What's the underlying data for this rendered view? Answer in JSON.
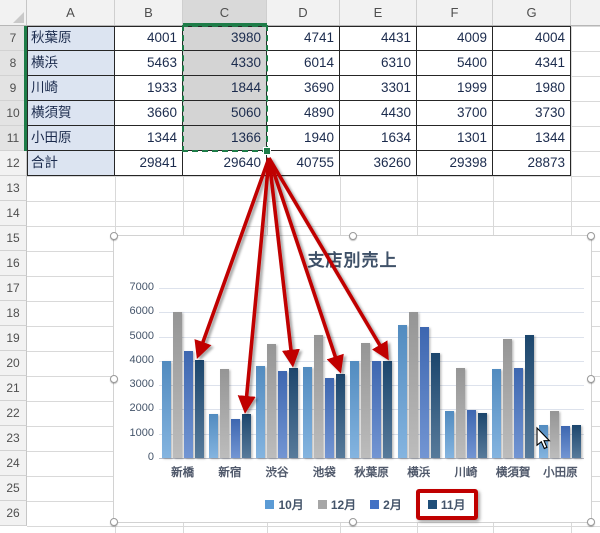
{
  "sheet": {
    "column_headers": [
      "A",
      "B",
      "C",
      "D",
      "E",
      "F",
      "G"
    ],
    "row_numbers": [
      "7",
      "8",
      "9",
      "10",
      "11",
      "12",
      "13",
      "14",
      "15",
      "16",
      "17",
      "18",
      "19",
      "20",
      "21",
      "22",
      "23",
      "24",
      "25",
      "26"
    ],
    "selection": {
      "column": "C",
      "row_start": 7,
      "row_end": 11
    },
    "table_rows": [
      {
        "row": "7",
        "label": "秋葉原",
        "values": [
          "4001",
          "3980",
          "4741",
          "4431",
          "4009",
          "4004"
        ]
      },
      {
        "row": "8",
        "label": "横浜",
        "values": [
          "5463",
          "4330",
          "6014",
          "6310",
          "5400",
          "4341"
        ]
      },
      {
        "row": "9",
        "label": "川崎",
        "values": [
          "1933",
          "1844",
          "3690",
          "3301",
          "1999",
          "1980"
        ]
      },
      {
        "row": "10",
        "label": "横須賀",
        "values": [
          "3660",
          "5060",
          "4890",
          "4430",
          "3700",
          "3730"
        ]
      },
      {
        "row": "11",
        "label": "小田原",
        "values": [
          "1344",
          "1366",
          "1940",
          "1634",
          "1301",
          "1344"
        ]
      },
      {
        "row": "12",
        "label": "合計",
        "values": [
          "29841",
          "29640",
          "40755",
          "36260",
          "29398",
          "28873"
        ]
      }
    ]
  },
  "chart_data": {
    "type": "bar",
    "title": "支店別売上",
    "categories": [
      "新橋",
      "新宿",
      "渋谷",
      "池袋",
      "秋葉原",
      "横浜",
      "川崎",
      "横須賀",
      "小田原"
    ],
    "series": [
      {
        "name": "10月",
        "color": "#5B9BD5",
        "values": [
          4000,
          1800,
          3800,
          3750,
          4001,
          5463,
          1933,
          3660,
          1344
        ]
      },
      {
        "name": "12月",
        "color": "#A6A6A6",
        "values": [
          6000,
          3650,
          4700,
          5050,
          4741,
          6014,
          3690,
          4890,
          1940
        ]
      },
      {
        "name": "2月",
        "color": "#4472C4",
        "values": [
          4400,
          1600,
          3600,
          3300,
          4009,
          5400,
          1999,
          3700,
          1301
        ]
      },
      {
        "name": "11月",
        "color": "#1F4E79",
        "values": [
          4050,
          1800,
          3700,
          3450,
          3980,
          4330,
          1844,
          5060,
          1366
        ]
      }
    ],
    "ylim": [
      0,
      7000
    ],
    "ytick_step": 1000,
    "grid": true,
    "legend_position": "bottom",
    "legend_highlight_series": "11月",
    "legend_highlight_color": "#C00000"
  },
  "annotations": {
    "arrow_color": "#C00000",
    "arrow_target_series": "11月",
    "arrow_targets": [
      "新橋",
      "新宿",
      "渋谷",
      "池袋",
      "秋葉原"
    ]
  }
}
